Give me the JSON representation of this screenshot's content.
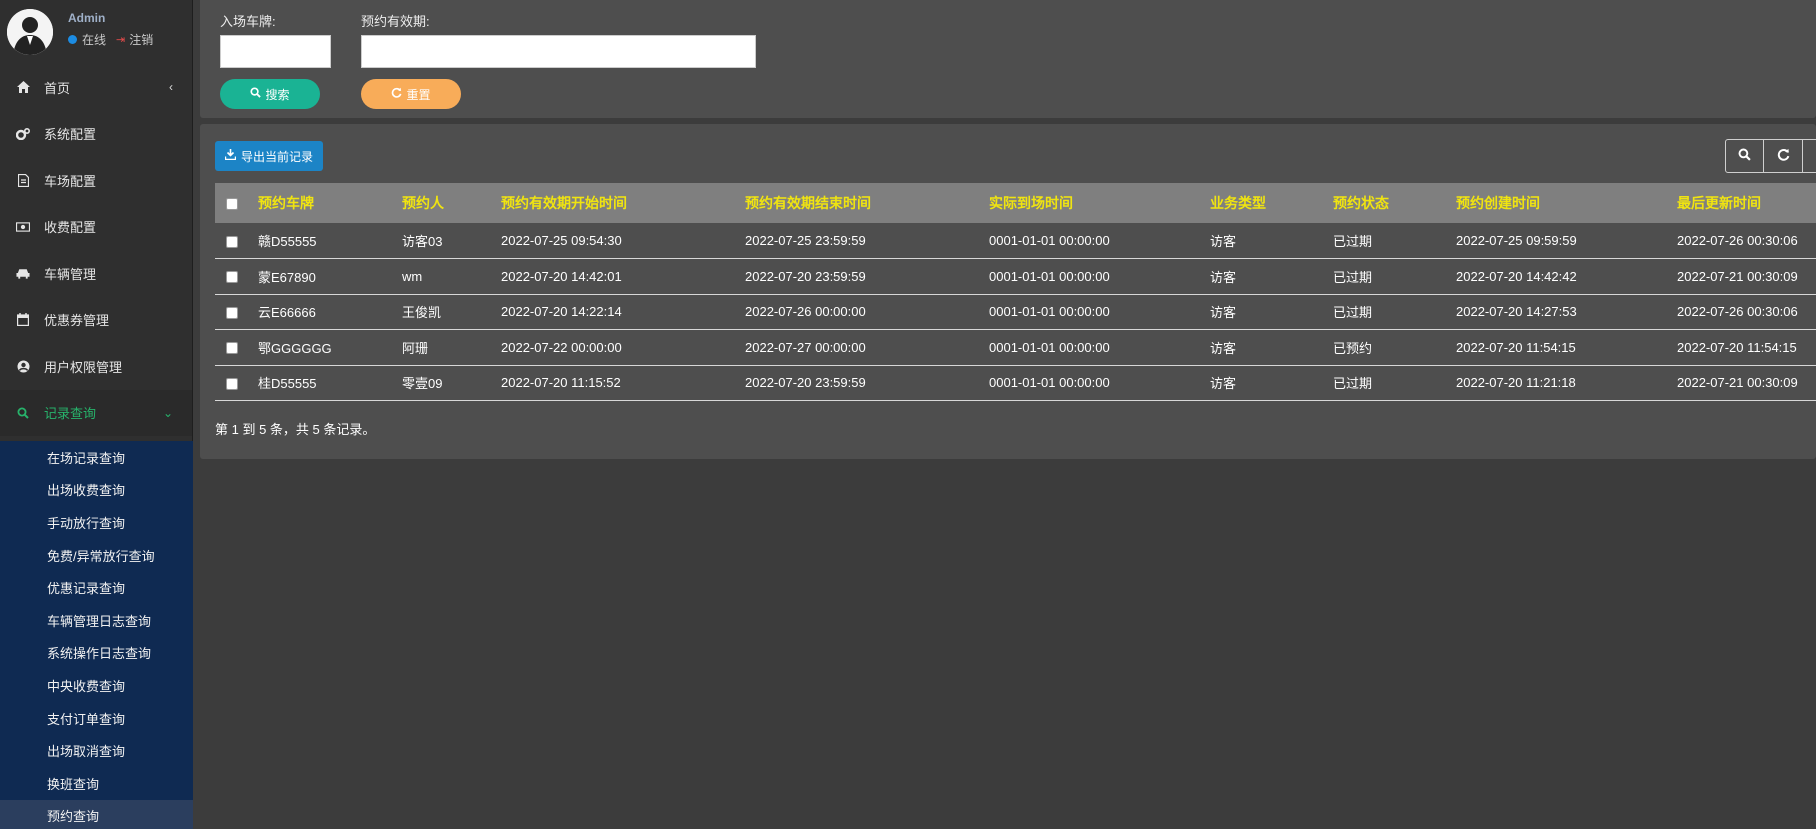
{
  "user": {
    "name": "Admin",
    "status": "在线",
    "logout": "注销"
  },
  "nav": {
    "home": "首页",
    "system": "系统配置",
    "parking": "车场配置",
    "charge": "收费配置",
    "vehicle": "车辆管理",
    "coupon": "优惠券管理",
    "permission": "用户权限管理",
    "records": "记录查询"
  },
  "submenu": [
    "在场记录查询",
    "出场收费查询",
    "手动放行查询",
    "免费/异常放行查询",
    "优惠记录查询",
    "车辆管理日志查询",
    "系统操作日志查询",
    "中央收费查询",
    "支付订单查询",
    "出场取消查询",
    "换班查询",
    "预约查询"
  ],
  "filter": {
    "plate_label": "入场车牌:",
    "plate_value": "",
    "validity_label": "预约有效期:",
    "validity_value": "",
    "search": "搜索",
    "reset": "重置"
  },
  "toolbar": {
    "export": "导出当前记录"
  },
  "table": {
    "headers": [
      "预约车牌",
      "预约人",
      "预约有效期开始时间",
      "预约有效期结束时间",
      "实际到场时间",
      "业务类型",
      "预约状态",
      "预约创建时间",
      "最后更新时间"
    ],
    "rows": [
      [
        "赣D55555",
        "访客03",
        "2022-07-25 09:54:30",
        "2022-07-25 23:59:59",
        "0001-01-01 00:00:00",
        "访客",
        "已过期",
        "2022-07-25 09:59:59",
        "2022-07-26 00:30:06"
      ],
      [
        "蒙E67890",
        "wm",
        "2022-07-20 14:42:01",
        "2022-07-20 23:59:59",
        "0001-01-01 00:00:00",
        "访客",
        "已过期",
        "2022-07-20 14:42:42",
        "2022-07-21 00:30:09"
      ],
      [
        "云E66666",
        "王俊凯",
        "2022-07-20 14:22:14",
        "2022-07-26 00:00:00",
        "0001-01-01 00:00:00",
        "访客",
        "已过期",
        "2022-07-20 14:27:53",
        "2022-07-26 00:30:06"
      ],
      [
        "鄂GGGGGG",
        "阿珊",
        "2022-07-22 00:00:00",
        "2022-07-27 00:00:00",
        "0001-01-01 00:00:00",
        "访客",
        "已预约",
        "2022-07-20 11:54:15",
        "2022-07-20 11:54:15"
      ],
      [
        "桂D55555",
        "零壹09",
        "2022-07-20 11:15:52",
        "2022-07-20 23:59:59",
        "0001-01-01 00:00:00",
        "访客",
        "已过期",
        "2022-07-20 11:21:18",
        "2022-07-21 00:30:09"
      ]
    ]
  },
  "pager": "第 1 到 5 条，共 5 条记录。",
  "colors": {
    "accent_green": "#1ab394",
    "reset_orange": "#f8ac59",
    "export_blue": "#1c84c6",
    "header_text": "#f0e410",
    "submenu_bg": "#0f2a52"
  }
}
